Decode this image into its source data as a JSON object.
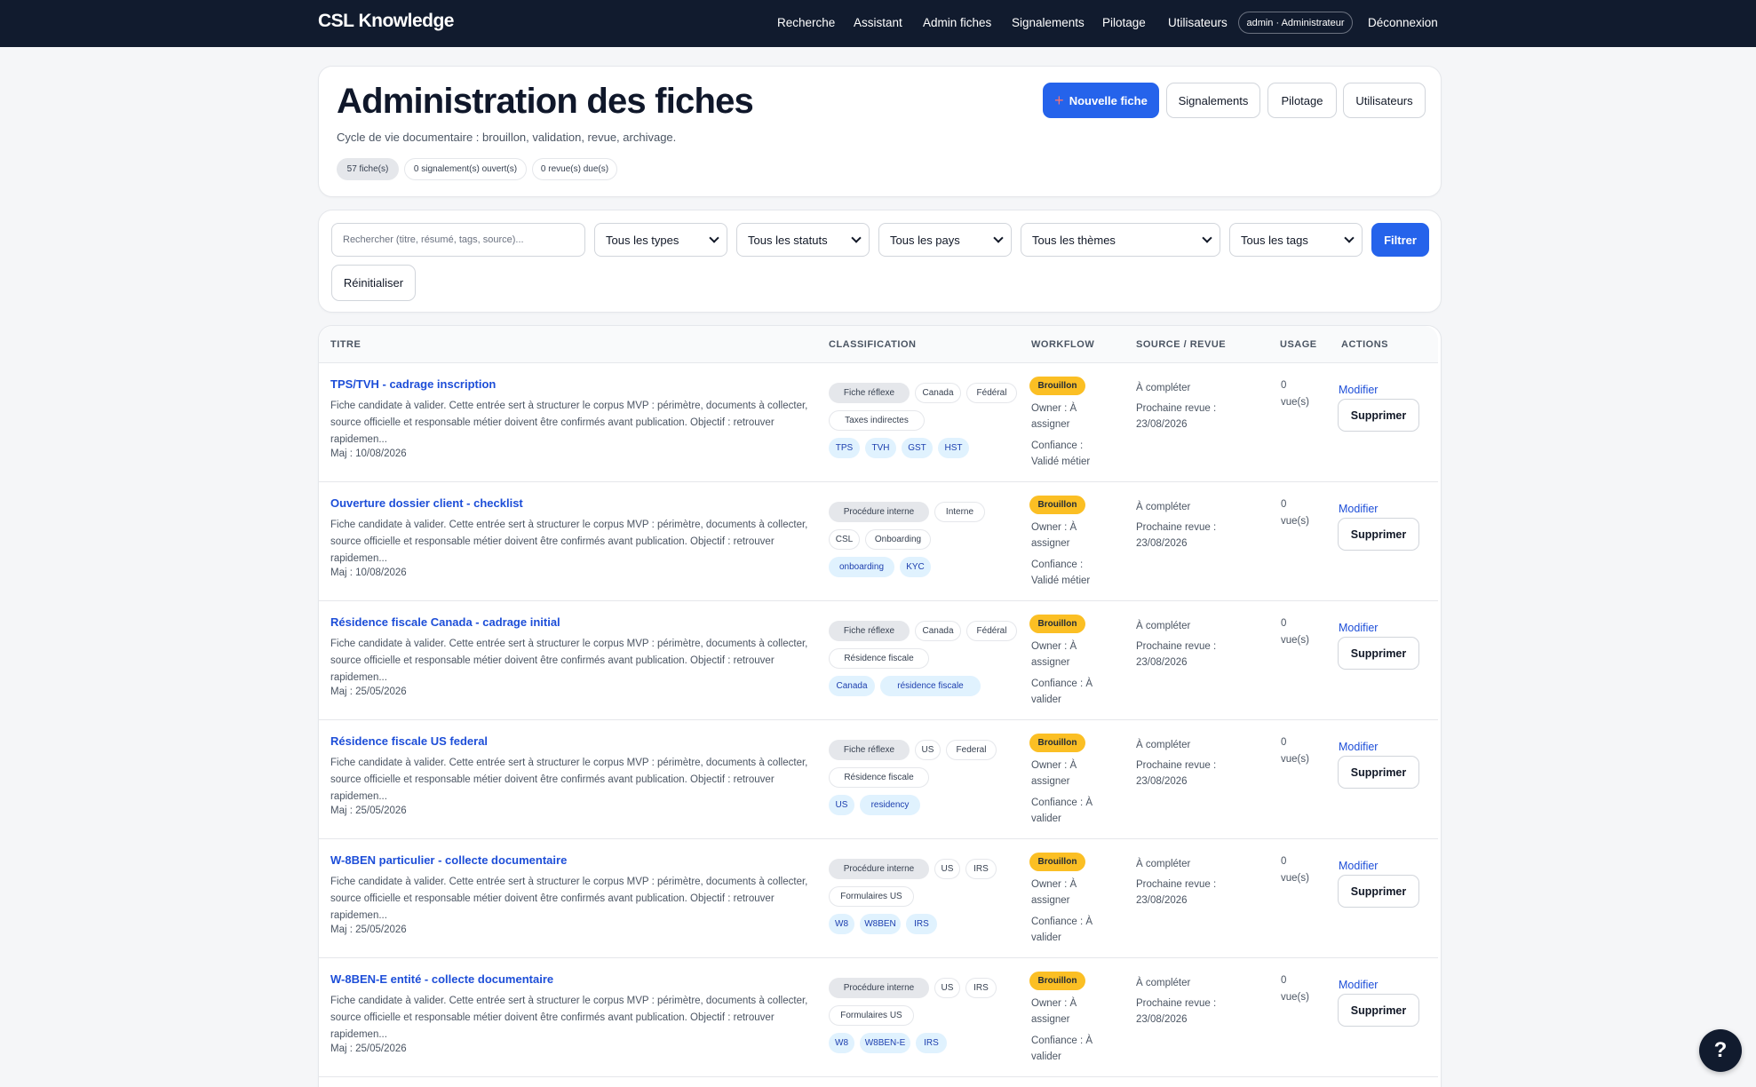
{
  "nav": {
    "brand": "CSL Knowledge",
    "links": [
      "Recherche",
      "Assistant",
      "Admin fiches",
      "Signalements",
      "Pilotage",
      "Utilisateurs"
    ],
    "user": "admin · Administrateur",
    "logout": "Déconnexion"
  },
  "header": {
    "title": "Administration des fiches",
    "subtitle": "Cycle de vie documentaire : brouillon, validation, revue, archivage.",
    "stats": [
      "57 fiche(s)",
      "0 signalement(s) ouvert(s)",
      "0 revue(s) due(s)"
    ],
    "new_button": "Nouvelle fiche",
    "buttons": [
      "Signalements",
      "Pilotage",
      "Utilisateurs"
    ]
  },
  "filters": {
    "search_placeholder": "Rechercher (titre, résumé, tags, source)...",
    "selects": [
      "Tous les types",
      "Tous les statuts",
      "Tous les pays",
      "Tous les thèmes",
      "Tous les tags"
    ],
    "filter_button": "Filtrer",
    "reset_button": "Réinitialiser"
  },
  "table": {
    "columns": [
      "TITRE",
      "CLASSIFICATION",
      "WORKFLOW",
      "SOURCE / REVUE",
      "USAGE",
      "ACTIONS"
    ],
    "labels": {
      "owner": "Owner : À assigner",
      "source": "À compléter",
      "review_prefix": "Prochaine revue :",
      "views_suffix": "vue(s)",
      "edit": "Modifier",
      "delete": "Supprimer"
    },
    "rows": [
      {
        "title": "TPS/TVH - cadrage inscription",
        "desc": "Fiche candidate à valider. Cette entrée sert à structurer le corpus MVP : périmètre, documents à collecter, source officielle et responsable métier doivent être confirmés avant publication. Objectif : retrouver rapidemen...",
        "date": "Maj : 10/08/2026",
        "type": "Fiche réflexe",
        "meta": [
          "Canada",
          "Fédéral",
          "Taxes indirectes"
        ],
        "tags": [
          "TPS",
          "TVH",
          "GST",
          "HST"
        ],
        "status": "Brouillon",
        "confidence": "Confiance : Validé métier",
        "review": "23/08/2026",
        "views": "0"
      },
      {
        "title": "Ouverture dossier client - checklist",
        "desc": "Fiche candidate à valider. Cette entrée sert à structurer le corpus MVP : périmètre, documents à collecter, source officielle et responsable métier doivent être confirmés avant publication. Objectif : retrouver rapidemen...",
        "date": "Maj : 10/08/2026",
        "type": "Procédure interne",
        "meta": [
          "Interne",
          "CSL",
          "Onboarding"
        ],
        "tags": [
          "onboarding",
          "KYC"
        ],
        "status": "Brouillon",
        "confidence": "Confiance : Validé métier",
        "review": "23/08/2026",
        "views": "0"
      },
      {
        "title": "Résidence fiscale Canada - cadrage initial",
        "desc": "Fiche candidate à valider. Cette entrée sert à structurer le corpus MVP : périmètre, documents à collecter, source officielle et responsable métier doivent être confirmés avant publication. Objectif : retrouver rapidemen...",
        "date": "Maj : 25/05/2026",
        "type": "Fiche réflexe",
        "meta": [
          "Canada",
          "Fédéral",
          "Résidence fiscale"
        ],
        "tags": [
          "Canada",
          "résidence fiscale"
        ],
        "status": "Brouillon",
        "confidence": "Confiance : À valider",
        "review": "23/08/2026",
        "views": "0"
      },
      {
        "title": "Résidence fiscale US federal",
        "desc": "Fiche candidate à valider. Cette entrée sert à structurer le corpus MVP : périmètre, documents à collecter, source officielle et responsable métier doivent être confirmés avant publication. Objectif : retrouver rapidemen...",
        "date": "Maj : 25/05/2026",
        "type": "Fiche réflexe",
        "meta": [
          "US",
          "Federal",
          "Résidence fiscale"
        ],
        "tags": [
          "US",
          "residency"
        ],
        "status": "Brouillon",
        "confidence": "Confiance : À valider",
        "review": "23/08/2026",
        "views": "0"
      },
      {
        "title": "W-8BEN particulier - collecte documentaire",
        "desc": "Fiche candidate à valider. Cette entrée sert à structurer le corpus MVP : périmètre, documents à collecter, source officielle et responsable métier doivent être confirmés avant publication. Objectif : retrouver rapidemen...",
        "date": "Maj : 25/05/2026",
        "type": "Procédure interne",
        "meta": [
          "US",
          "IRS",
          "Formulaires US"
        ],
        "tags": [
          "W8",
          "W8BEN",
          "IRS"
        ],
        "status": "Brouillon",
        "confidence": "Confiance : À valider",
        "review": "23/08/2026",
        "views": "0"
      },
      {
        "title": "W-8BEN-E entité - collecte documentaire",
        "desc": "Fiche candidate à valider. Cette entrée sert à structurer le corpus MVP : périmètre, documents à collecter, source officielle et responsable métier doivent être confirmés avant publication. Objectif : retrouver rapidemen...",
        "date": "Maj : 25/05/2026",
        "type": "Procédure interne",
        "meta": [
          "US",
          "IRS",
          "Formulaires US"
        ],
        "tags": [
          "W8",
          "W8BEN-E",
          "IRS"
        ],
        "status": "Brouillon",
        "confidence": "Confiance : À valider",
        "review": "23/08/2026",
        "views": "0"
      }
    ]
  },
  "help": "?"
}
